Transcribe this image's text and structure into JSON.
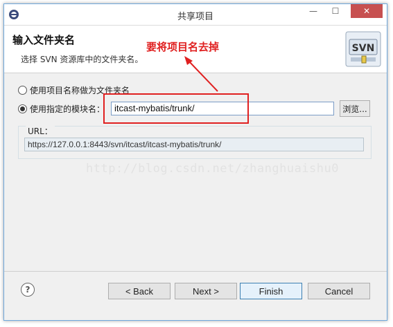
{
  "window": {
    "title": "共享项目",
    "minimize": "—",
    "maximize": "☐",
    "close": "✕"
  },
  "header": {
    "title": "输入文件夹名",
    "description": "选择 SVN 资源库中的文件夹名。",
    "logo_text": "SVN"
  },
  "annotation": {
    "text": "要将项目名去掉"
  },
  "options": {
    "use_project_name": "使用项目名称做为文件夹名",
    "use_module_name": "使用指定的模块名：",
    "selected": "use_module_name"
  },
  "module": {
    "value": "itcast-mybatis/trunk/",
    "browse_label": "浏览..."
  },
  "url": {
    "label": "URL：",
    "value": "https://127.0.0.1:8443/svn/itcast/itcast-mybatis/trunk/"
  },
  "watermark": "http://blog.csdn.net/zhanghuaishu0",
  "buttons": {
    "help": "?",
    "back": "< Back",
    "next": "Next >",
    "finish": "Finish",
    "cancel": "Cancel"
  },
  "colors": {
    "annotation": "#e02020",
    "close_button": "#c75050",
    "window_border": "#6fa8dc"
  }
}
